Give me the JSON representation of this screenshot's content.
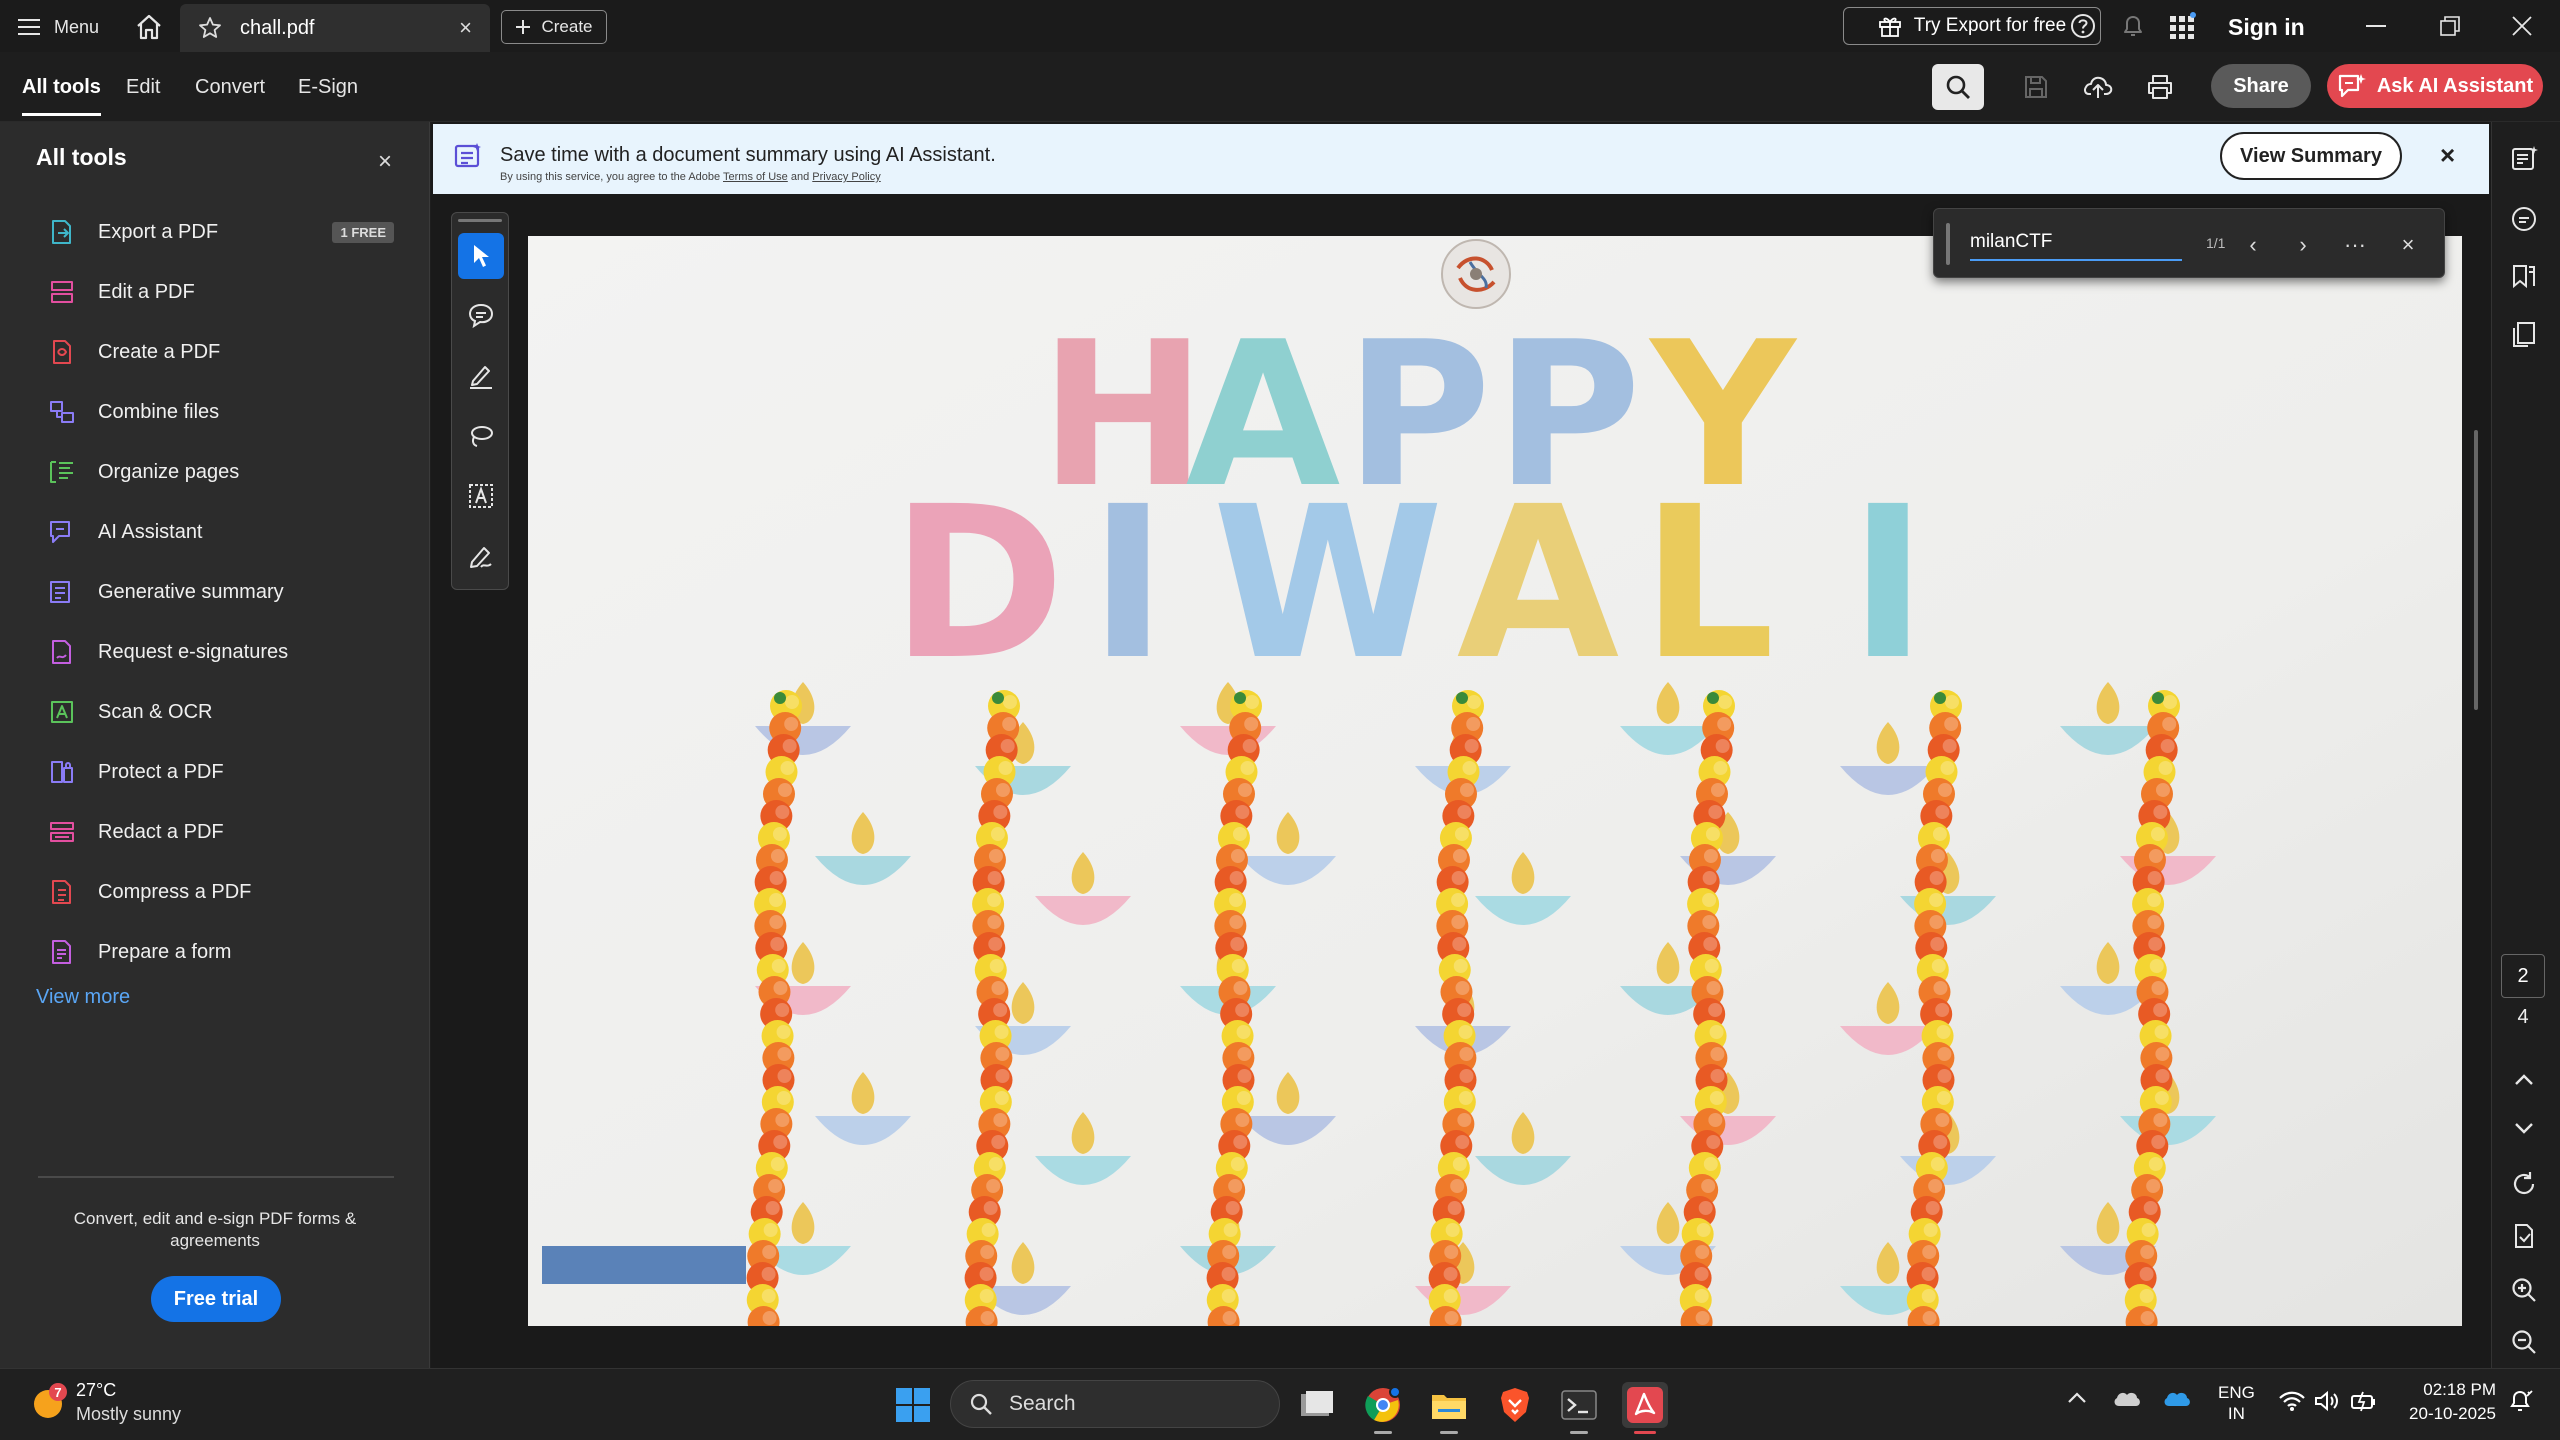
{
  "titlebar": {
    "menu_label": "Menu",
    "tab_title": "chall.pdf",
    "tab_close": "×",
    "create_label": "Create",
    "try_export_label": "Try Export for free",
    "sign_in_label": "Sign in"
  },
  "toolbar": {
    "tabs": [
      "All tools",
      "Edit",
      "Convert",
      "E-Sign"
    ],
    "share_label": "Share",
    "ask_ai_label": "Ask AI Assistant"
  },
  "left_panel": {
    "title": "All tools",
    "close": "×",
    "items": [
      {
        "label": "Export a PDF",
        "icon": "export-pdf-icon",
        "color": "#3fb6c9",
        "badge": "1 FREE"
      },
      {
        "label": "Edit a PDF",
        "icon": "edit-pdf-icon",
        "color": "#e34fa0"
      },
      {
        "label": "Create a PDF",
        "icon": "create-pdf-icon",
        "color": "#e34850"
      },
      {
        "label": "Combine files",
        "icon": "combine-files-icon",
        "color": "#8b7cf6"
      },
      {
        "label": "Organize pages",
        "icon": "organize-pages-icon",
        "color": "#5bc35b"
      },
      {
        "label": "AI Assistant",
        "icon": "ai-assistant-icon",
        "color": "#8b7cf6"
      },
      {
        "label": "Generative summary",
        "icon": "generative-summary-icon",
        "color": "#8b7cf6"
      },
      {
        "label": "Request e-signatures",
        "icon": "request-esignatures-icon",
        "color": "#c45fe0"
      },
      {
        "label": "Scan & OCR",
        "icon": "scan-ocr-icon",
        "color": "#5bc35b"
      },
      {
        "label": "Protect a PDF",
        "icon": "protect-pdf-icon",
        "color": "#8b7cf6"
      },
      {
        "label": "Redact a PDF",
        "icon": "redact-pdf-icon",
        "color": "#e34fa0"
      },
      {
        "label": "Compress a PDF",
        "icon": "compress-pdf-icon",
        "color": "#e34850"
      },
      {
        "label": "Prepare a form",
        "icon": "prepare-form-icon",
        "color": "#c45fe0"
      }
    ],
    "view_more": "View more",
    "promo_text": "Convert, edit and e-sign PDF forms & agreements",
    "free_trial": "Free trial"
  },
  "banner": {
    "title": "Save time with a document summary using AI Assistant.",
    "sub_prefix": "By using this service, you agree to the Adobe",
    "terms": "Terms of Use",
    "and": "and",
    "privacy": "Privacy Policy",
    "view_summary": "View Summary",
    "close": "×"
  },
  "find": {
    "query": "milanCTF",
    "count": "1/1",
    "prev": "‹",
    "next": "›",
    "more": "···",
    "close": "×"
  },
  "page_nav": {
    "current": "2",
    "total": "4"
  },
  "document": {
    "line1": [
      "H",
      "A",
      "P",
      "P",
      "Y"
    ],
    "line2": [
      "D",
      "I",
      "W",
      "A",
      "L",
      "I"
    ],
    "line1_colors": [
      "#e8a3b0",
      "#8fd0d0",
      "#a3bfe0",
      "#a3bfe0",
      "#ecc75a"
    ],
    "line2_colors": [
      "#eba3b8",
      "#a3bfe0",
      "#a3c9e8",
      "#e9cf78",
      "#eacb5c",
      "#8fd0d8"
    ]
  },
  "taskbar": {
    "weather_badge": "7",
    "temp": "27°C",
    "desc": "Mostly sunny",
    "search": "Search",
    "lang_top": "ENG",
    "lang_bottom": "IN",
    "time": "02:18 PM",
    "date": "20-10-2025"
  }
}
